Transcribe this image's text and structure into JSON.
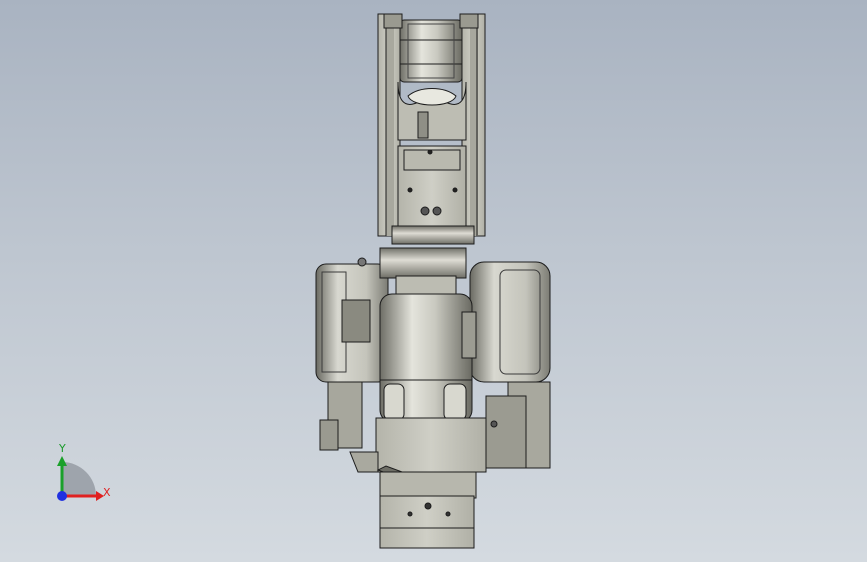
{
  "triad": {
    "x_label": "X",
    "y_label": "Y",
    "x_color": "#e02020",
    "y_color": "#1aa02a",
    "z_color": "#2030e0"
  },
  "model": {
    "body_color": "#c2c2b8",
    "shadow_color": "#6f6f67",
    "edge_color": "#1c1c1c"
  }
}
